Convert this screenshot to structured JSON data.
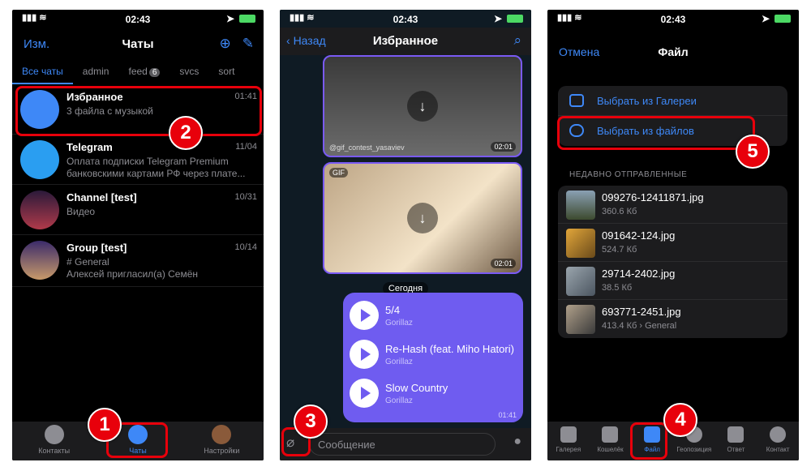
{
  "status": {
    "time": "02:43"
  },
  "phone1": {
    "header": {
      "edit": "Изм.",
      "title": "Чаты"
    },
    "folders": [
      {
        "label": "Все чаты",
        "active": true
      },
      {
        "label": "admin"
      },
      {
        "label": "feed",
        "badge": "6"
      },
      {
        "label": "svcs"
      },
      {
        "label": "sort"
      }
    ],
    "chats": [
      {
        "name": "Избранное",
        "date": "01:41",
        "msg": "3 файла с музыкой"
      },
      {
        "name": "Telegram",
        "date": "11/04",
        "msg": "Оплата подписки Telegram Premium банковскими картами РФ через плате..."
      },
      {
        "name": "Channel [test]",
        "date": "10/31",
        "msg": "Видео"
      },
      {
        "name": "Group [test]",
        "date": "10/14",
        "msg": "# General",
        "msg2": "Алексей пригласил(а) Семён"
      }
    ],
    "tabs": {
      "contacts": "Контакты",
      "chats": "Чаты",
      "settings": "Настройки"
    }
  },
  "phone2": {
    "header": {
      "back": "Назад",
      "title": "Избранное"
    },
    "media1": {
      "time": "02:01",
      "sender": "@gif_contest_yasaviev"
    },
    "media2": {
      "tag": "GIF",
      "time": "02:01"
    },
    "date_divider": "Сегодня",
    "tracks": [
      {
        "title": "5/4",
        "artist": "Gorillaz"
      },
      {
        "title": "Re-Hash (feat. Miho Hatori)",
        "artist": "Gorillaz"
      },
      {
        "title": "Slow Country",
        "artist": "Gorillaz"
      }
    ],
    "music_time": "01:41",
    "input_placeholder": "Сообщение"
  },
  "phone3": {
    "header": {
      "cancel": "Отмена",
      "title": "Файл"
    },
    "menu": {
      "gallery": "Выбрать из Галереи",
      "files": "Выбрать из файлов"
    },
    "recent_title": "НЕДАВНО ОТПРАВЛЕННЫЕ",
    "files": [
      {
        "name": "099276-12411871.jpg",
        "size": "360.6 Кб"
      },
      {
        "name": "091642-124.jpg",
        "size": "524.7 Кб"
      },
      {
        "name": "29714-2402.jpg",
        "size": "38.5 Кб"
      },
      {
        "name": "693771-2451.jpg",
        "size": "413.4 Кб › General"
      }
    ],
    "attach": [
      "Галерея",
      "Кошелёк",
      "Файл",
      "Геопозиция",
      "Ответ",
      "Контакт"
    ]
  },
  "markers": [
    "1",
    "2",
    "3",
    "4",
    "5"
  ]
}
